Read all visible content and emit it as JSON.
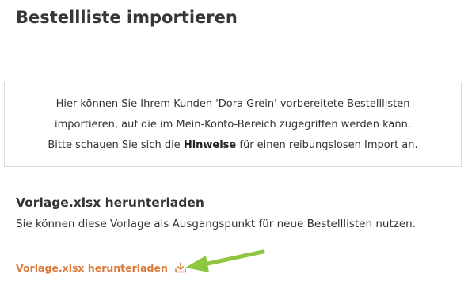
{
  "page": {
    "title": "Bestellliste importieren"
  },
  "info": {
    "line1": "Hier können Sie Ihrem Kunden 'Dora Grein' vorbereitete Bestelllisten",
    "line2": "importieren, auf die im Mein-Konto-Bereich zugegriffen werden kann.",
    "line3_before": "Bitte schauen Sie sich die ",
    "line3_bold": "Hinweise",
    "line3_after": " für einen reibungslosen Import an."
  },
  "template": {
    "heading": "Vorlage.xlsx herunterladen",
    "description": "Sie können diese Vorlage als Ausgangspunkt für neue Bestelllisten nutzen.",
    "link_label": "Vorlage.xlsx herunterladen",
    "link_icon": "download-icon"
  },
  "colors": {
    "link": "#d97a3a",
    "annotation_arrow": "#8fc63f",
    "border": "#dcdcdc"
  }
}
